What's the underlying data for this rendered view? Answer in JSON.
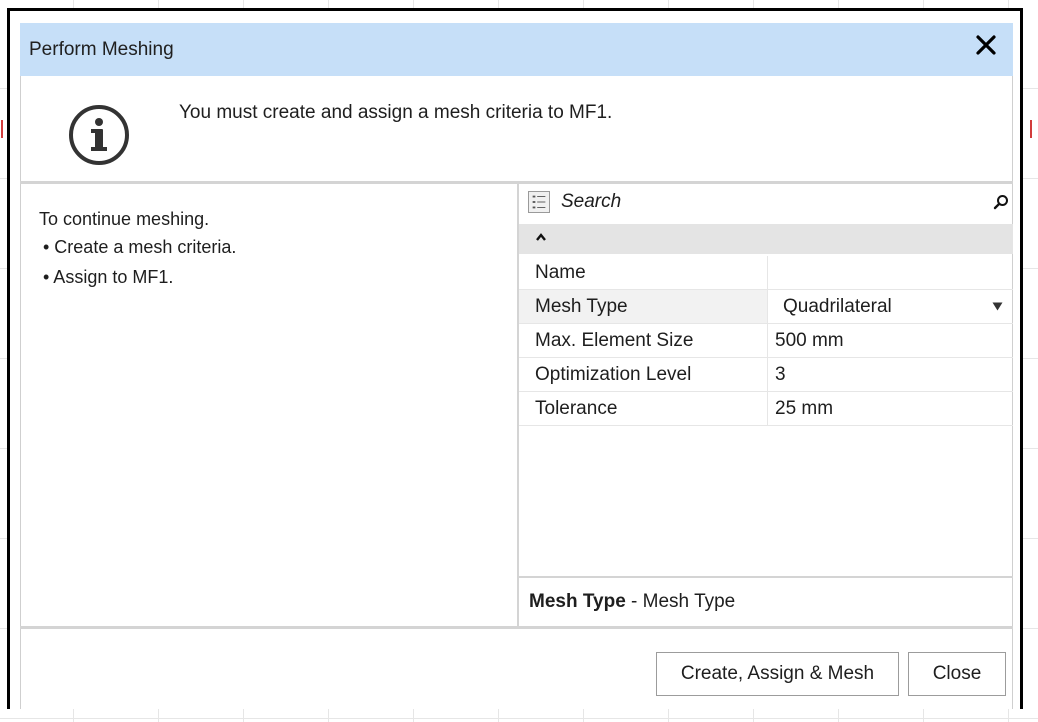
{
  "dialog": {
    "title": "Perform Meshing",
    "message": "You must create and assign a mesh criteria to MF1.",
    "instructions": {
      "intro": "To continue meshing.",
      "bullets": [
        "• Create a mesh criteria.",
        "• Assign to MF1."
      ]
    },
    "properties": {
      "search_placeholder": "Search",
      "rows": [
        {
          "name": "Name",
          "value": ""
        },
        {
          "name": "Mesh Type",
          "value": "Quadrilateral"
        },
        {
          "name": "Max. Element Size",
          "value": "500 mm"
        },
        {
          "name": "Optimization Level",
          "value": "3"
        },
        {
          "name": "Tolerance",
          "value": "25 mm"
        }
      ],
      "description_label": "Mesh Type",
      "description_text": " - Mesh Type"
    },
    "buttons": {
      "primary": "Create, Assign & Mesh",
      "close": "Close"
    }
  },
  "colors": {
    "title_bar": "#c6dff8",
    "border": "#000000",
    "selected_row": "#f2f2f2"
  },
  "icons": [
    "close-icon",
    "info-icon",
    "categorize-icon",
    "search-icon",
    "collapse-caret-icon",
    "dropdown-arrow-icon"
  ]
}
